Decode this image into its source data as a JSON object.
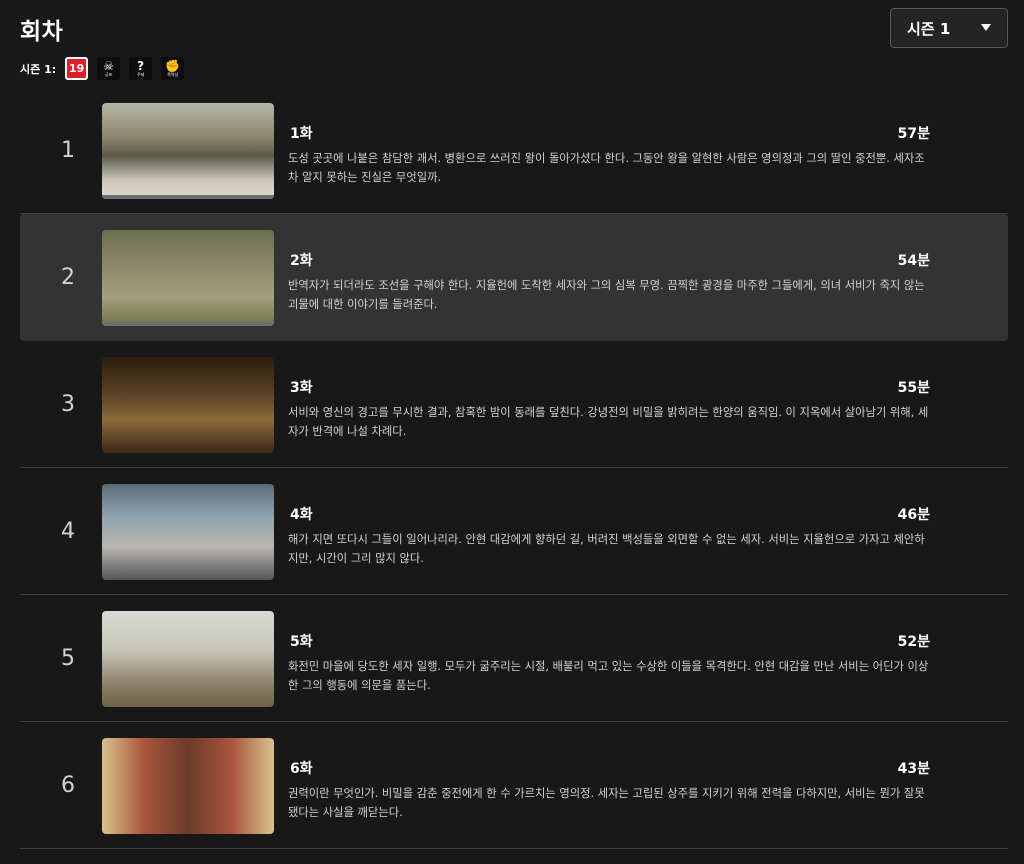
{
  "header": {
    "title": "회차",
    "season_select": "시즌 1"
  },
  "ratings": {
    "label": "시즌 1:",
    "icons": [
      {
        "name": "age-19-icon",
        "text": "19",
        "sub": ""
      },
      {
        "name": "fear-icon",
        "text": "☠",
        "sub": "공포"
      },
      {
        "name": "theme-icon",
        "text": "?",
        "sub": "주제"
      },
      {
        "name": "violence-icon",
        "text": "✊",
        "sub": "폭력성"
      }
    ]
  },
  "episodes": [
    {
      "index": "1",
      "title": "1화",
      "duration": "57분",
      "desc": "도성 곳곳에 나붙은 참담한 괘서. 병환으로 쓰러진 왕이 돌아가셨다 한다. 그동안 왕을 알현한 사람은 영의정과 그의 딸인 중전뿐. 세자조차 알지 못하는 진실은 무엇일까."
    },
    {
      "index": "2",
      "title": "2화",
      "duration": "54분",
      "desc": "반역자가 되더라도 조선을 구해야 한다. 지율헌에 도착한 세자와 그의 심복 무영. 끔찍한 광경을 마주한 그들에게, 의녀 서비가 죽지 않는 괴물에 대한 이야기를 들려준다."
    },
    {
      "index": "3",
      "title": "3화",
      "duration": "55분",
      "desc": "서비와 영신의 경고를 무시한 결과, 참혹한 밤이 동래를 덮친다. 강녕전의 비밀을 밝히려는 한양의 움직임. 이 지옥에서 살아남기 위해, 세자가 반격에 나설 차례다."
    },
    {
      "index": "4",
      "title": "4화",
      "duration": "46분",
      "desc": "해가 지면 또다시 그들이 일어나리라. 안현 대감에게 향하던 길, 버려진 백성들을 외면할 수 없는 세자. 서비는 지율헌으로 가자고 제안하지만, 시간이 그리 많지 않다."
    },
    {
      "index": "5",
      "title": "5화",
      "duration": "52분",
      "desc": "화전민 마을에 당도한 세자 일행. 모두가 굶주리는 시절, 배불리 먹고 있는 수상한 이들을 목격한다. 안현 대감을 만난 서비는 어딘가 이상한 그의 행동에 의문을 품는다."
    },
    {
      "index": "6",
      "title": "6화",
      "duration": "43분",
      "desc": "권력이란 무엇인가. 비밀을 감춘 중전에게 한 수 가르치는 영의정. 세자는 고립된 상주를 지키기 위해 전력을 다하지만, 서비는 뭔가 잘못됐다는 사실을 깨닫는다."
    }
  ]
}
